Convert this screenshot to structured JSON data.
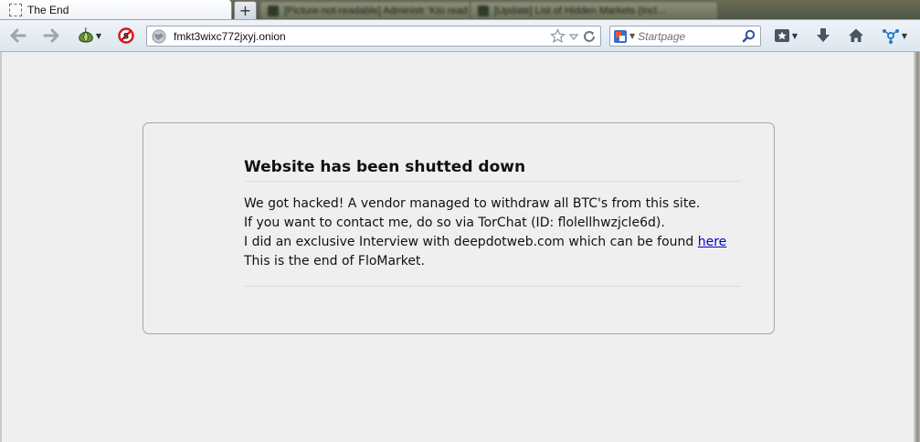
{
  "tabs": {
    "active_title": "The End",
    "new_tab_label": "+",
    "background": [
      {
        "title": "[Picture-not-readable] Administr 'Kto read ur Scammers…"
      },
      {
        "title": "[Update] List of Hidden Markets (Incl…"
      }
    ]
  },
  "navbar": {
    "url": "fmkt3wixc772jxyj.onion",
    "search_placeholder": "Startpage",
    "icons": {
      "back": "back-arrow-icon",
      "forward": "forward-arrow-icon",
      "tor": "tor-onion-icon",
      "noscript": "noscript-icon",
      "globe": "globe-icon",
      "star": "bookmark-star-icon",
      "reload": "reload-icon",
      "search_engine": "startpage-icon",
      "search": "search-icon",
      "bookmarks": "bookmarks-icon",
      "download": "download-icon",
      "home": "home-icon",
      "addon": "addon-icon"
    }
  },
  "notice": {
    "title": "Website has been shutted down",
    "line1": "We got hacked! A vendor managed to withdraw all BTC's from this site.",
    "line2": "If you want to contact me, do so via TorChat (ID: flolellhwzjcle6d).",
    "line3_prefix": "I did an exclusive Interview with deepdotweb.com which can be found ",
    "line3_link": "here",
    "line4": "This is the end of FloMarket."
  },
  "colors": {
    "link": "#0000cc",
    "page_background": "#efefef",
    "card_border": "#a6a6a6"
  }
}
